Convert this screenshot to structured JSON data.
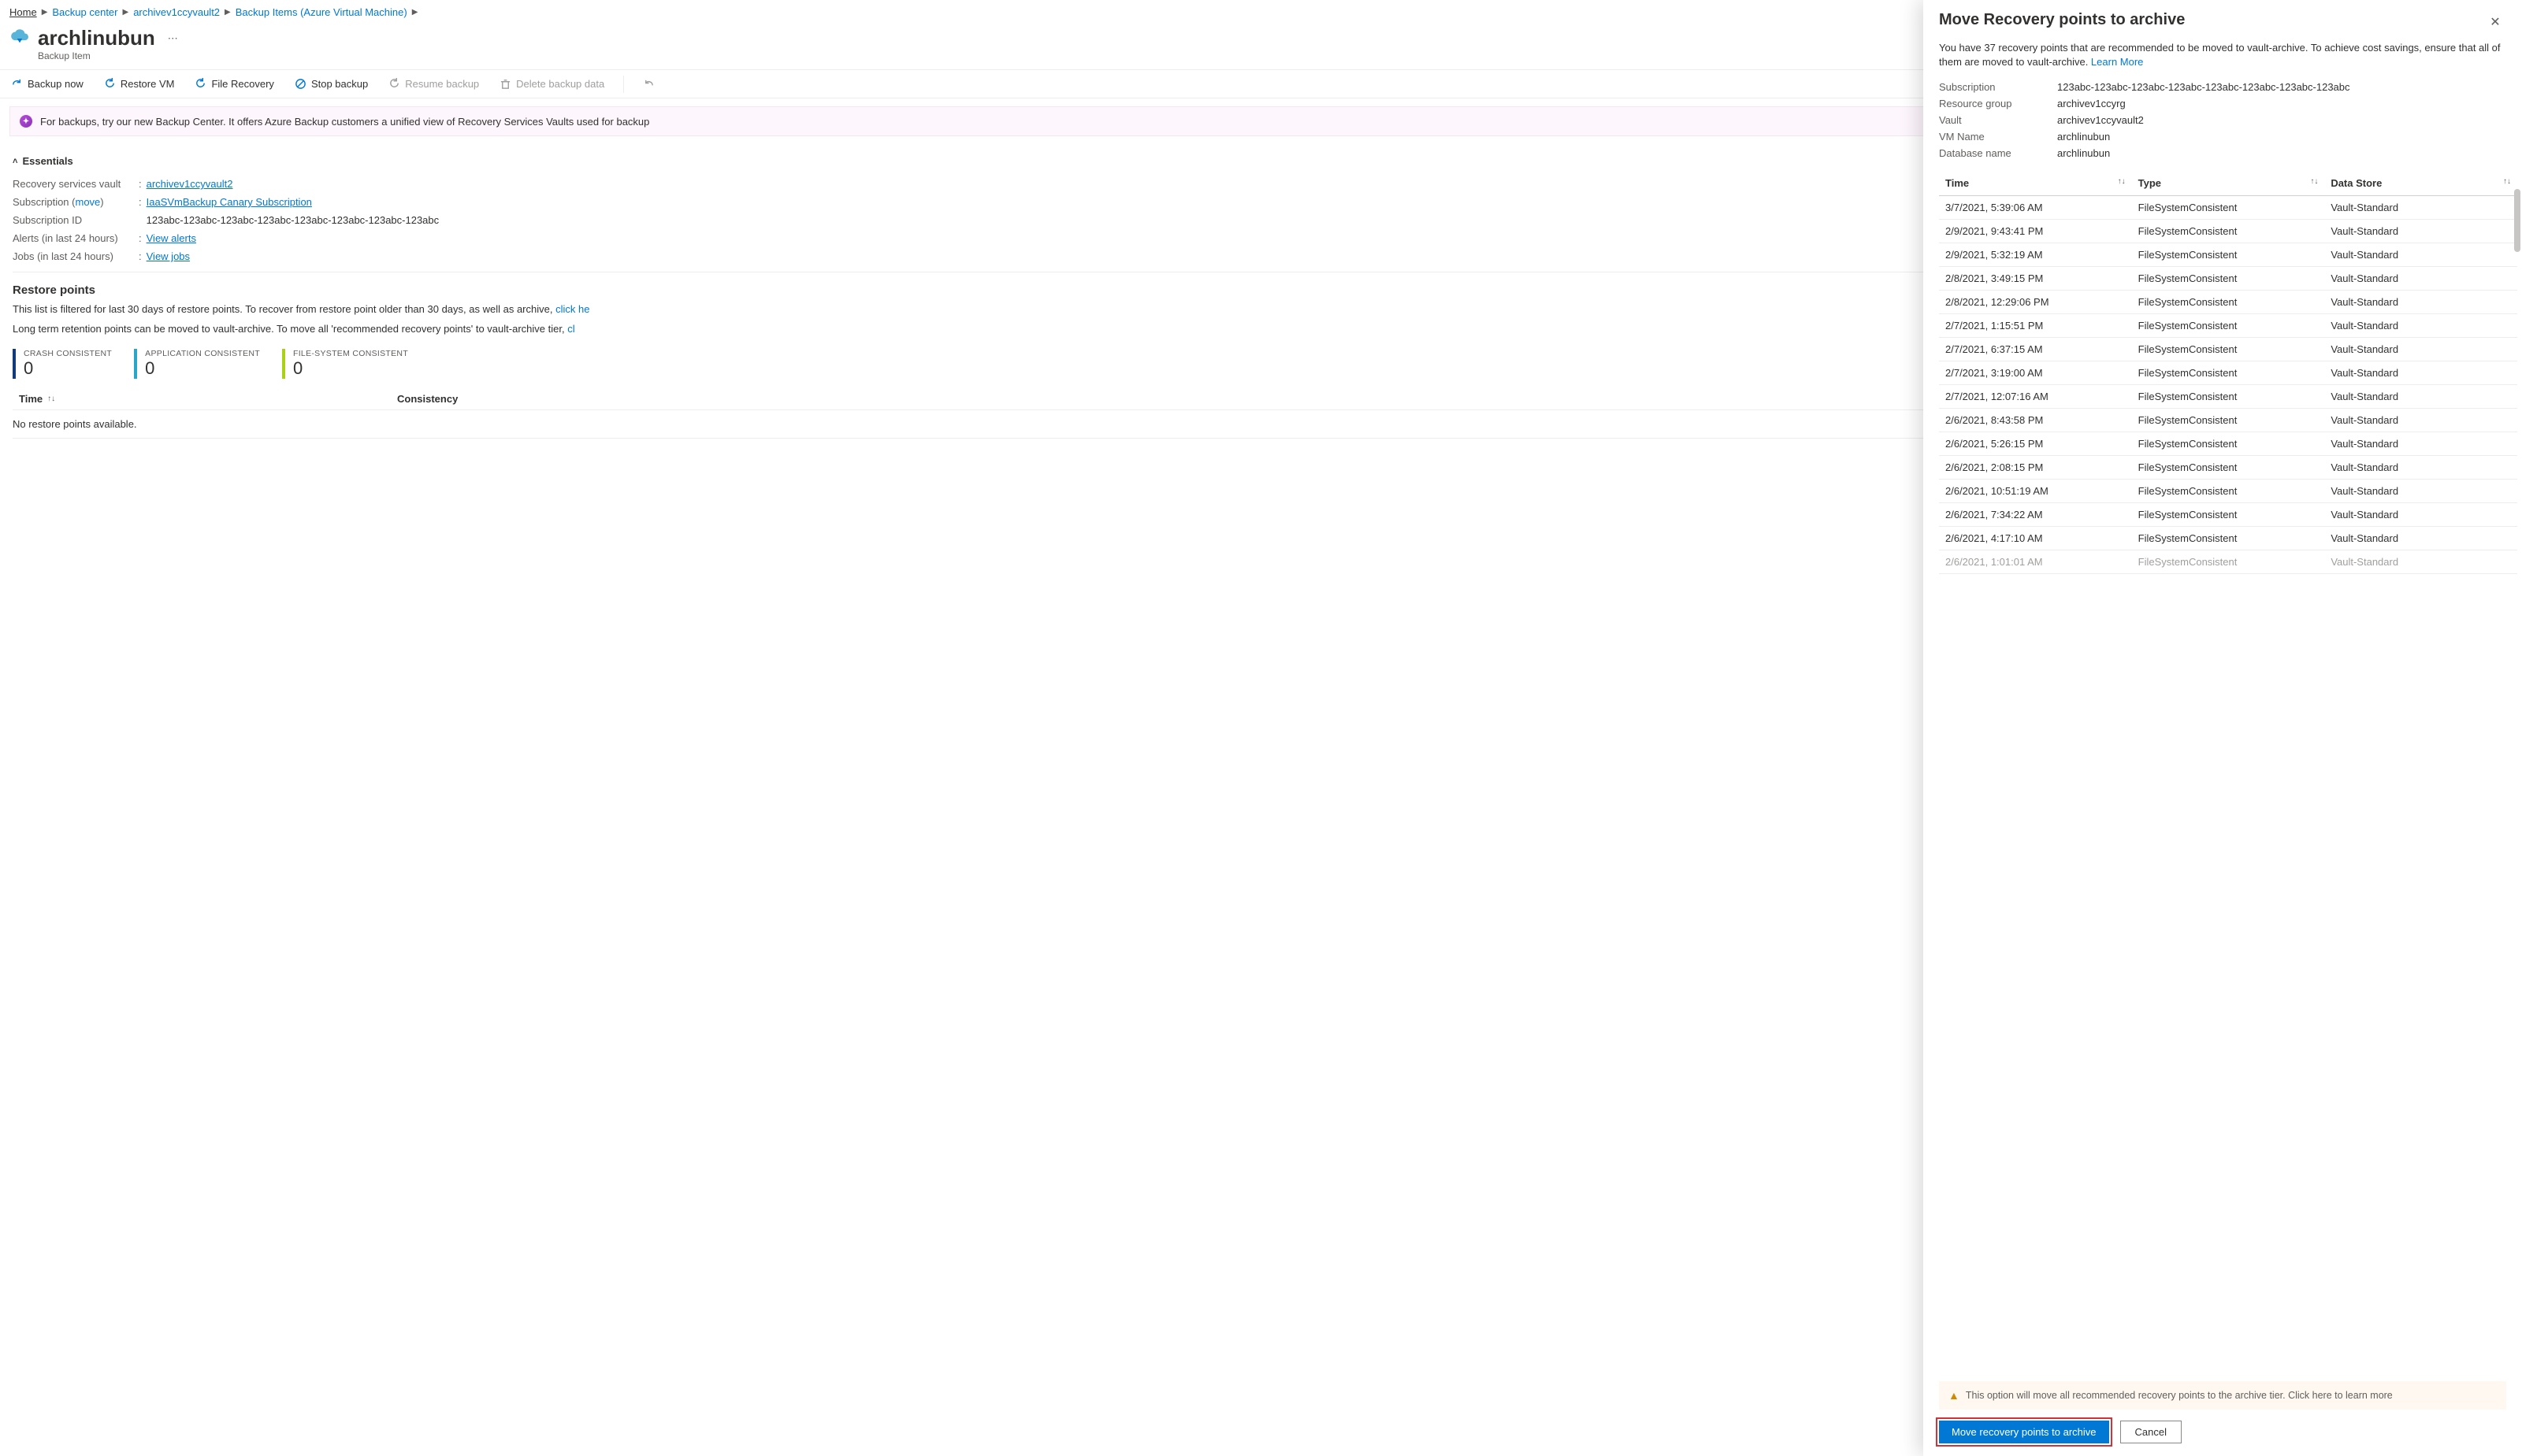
{
  "breadcrumb": {
    "items": [
      "Home",
      "Backup center",
      "archivev1ccyvault2",
      "Backup Items (Azure Virtual Machine)"
    ]
  },
  "title": "archlinubun",
  "subtitle": "Backup Item",
  "toolbar": {
    "backup_now": "Backup now",
    "restore_vm": "Restore VM",
    "file_recovery": "File Recovery",
    "stop_backup": "Stop backup",
    "resume_backup": "Resume backup",
    "delete_backup_data": "Delete backup data"
  },
  "banner": {
    "text": "For backups, try our new Backup Center. It offers Azure Backup customers a unified view of Recovery Services Vaults used for backup"
  },
  "essentials": {
    "toggle_label": "Essentials",
    "vault_label": "Recovery services vault",
    "vault_value": "archivev1ccyvault2",
    "sub_label_prefix": "Subscription (",
    "sub_label_link": "move",
    "sub_label_suffix": ")",
    "subscription_name": "IaaSVmBackup Canary Subscription",
    "subid_label": "Subscription ID",
    "subid_value": "123abc-123abc-123abc-123abc-123abc-123abc-123abc-123abc",
    "alerts_label": "Alerts (in last 24 hours)",
    "alerts_link": "View alerts",
    "jobs_label": "Jobs (in last 24 hours)",
    "jobs_link": "View jobs"
  },
  "restore": {
    "title": "Restore points",
    "text1_prefix": "This list is filtered for last 30 days of restore points. To recover from restore point older than 30 days, as well as archive, ",
    "text1_link": "click he",
    "text2_prefix": "Long term retention points can be moved to vault-archive. To move all 'recommended recovery points' to vault-archive tier, ",
    "text2_link": "cl",
    "metrics": {
      "crash_label": "CRASH CONSISTENT",
      "crash_val": "0",
      "app_label": "APPLICATION CONSISTENT",
      "app_val": "0",
      "fs_label": "FILE-SYSTEM CONSISTENT",
      "fs_val": "0"
    },
    "col_time": "Time",
    "col_consistency": "Consistency",
    "empty": "No restore points available."
  },
  "panel": {
    "title": "Move Recovery points to archive",
    "desc_prefix": "You have 37 recovery points that are recommended to be moved to vault-archive. To achieve cost savings, ensure that all of them are moved to vault-archive. ",
    "learn_more": "Learn More",
    "meta": {
      "subscription_label": "Subscription",
      "subscription_value": "123abc-123abc-123abc-123abc-123abc-123abc-123abc-123abc",
      "rg_label": "Resource group",
      "rg_value": "archivev1ccyrg",
      "vault_label": "Vault",
      "vault_value": "archivev1ccyvault2",
      "vm_label": "VM Name",
      "vm_value": "archlinubun",
      "db_label": "Database name",
      "db_value": "archlinubun"
    },
    "columns": {
      "time": "Time",
      "type": "Type",
      "store": "Data Store"
    },
    "rows": [
      {
        "time": "3/7/2021, 5:39:06 AM",
        "type": "FileSystemConsistent",
        "store": "Vault-Standard"
      },
      {
        "time": "2/9/2021, 9:43:41 PM",
        "type": "FileSystemConsistent",
        "store": "Vault-Standard"
      },
      {
        "time": "2/9/2021, 5:32:19 AM",
        "type": "FileSystemConsistent",
        "store": "Vault-Standard"
      },
      {
        "time": "2/8/2021, 3:49:15 PM",
        "type": "FileSystemConsistent",
        "store": "Vault-Standard"
      },
      {
        "time": "2/8/2021, 12:29:06 PM",
        "type": "FileSystemConsistent",
        "store": "Vault-Standard"
      },
      {
        "time": "2/7/2021, 1:15:51 PM",
        "type": "FileSystemConsistent",
        "store": "Vault-Standard"
      },
      {
        "time": "2/7/2021, 6:37:15 AM",
        "type": "FileSystemConsistent",
        "store": "Vault-Standard"
      },
      {
        "time": "2/7/2021, 3:19:00 AM",
        "type": "FileSystemConsistent",
        "store": "Vault-Standard"
      },
      {
        "time": "2/7/2021, 12:07:16 AM",
        "type": "FileSystemConsistent",
        "store": "Vault-Standard"
      },
      {
        "time": "2/6/2021, 8:43:58 PM",
        "type": "FileSystemConsistent",
        "store": "Vault-Standard"
      },
      {
        "time": "2/6/2021, 5:26:15 PM",
        "type": "FileSystemConsistent",
        "store": "Vault-Standard"
      },
      {
        "time": "2/6/2021, 2:08:15 PM",
        "type": "FileSystemConsistent",
        "store": "Vault-Standard"
      },
      {
        "time": "2/6/2021, 10:51:19 AM",
        "type": "FileSystemConsistent",
        "store": "Vault-Standard"
      },
      {
        "time": "2/6/2021, 7:34:22 AM",
        "type": "FileSystemConsistent",
        "store": "Vault-Standard"
      },
      {
        "time": "2/6/2021, 4:17:10 AM",
        "type": "FileSystemConsistent",
        "store": "Vault-Standard"
      },
      {
        "time": "2/6/2021, 1:01:01 AM",
        "type": "FileSystemConsistent",
        "store": "Vault-Standard"
      }
    ],
    "warning": "This option will move all recommended recovery points to the archive tier. Click here to learn more",
    "primary_btn": "Move recovery points to archive",
    "cancel_btn": "Cancel"
  }
}
